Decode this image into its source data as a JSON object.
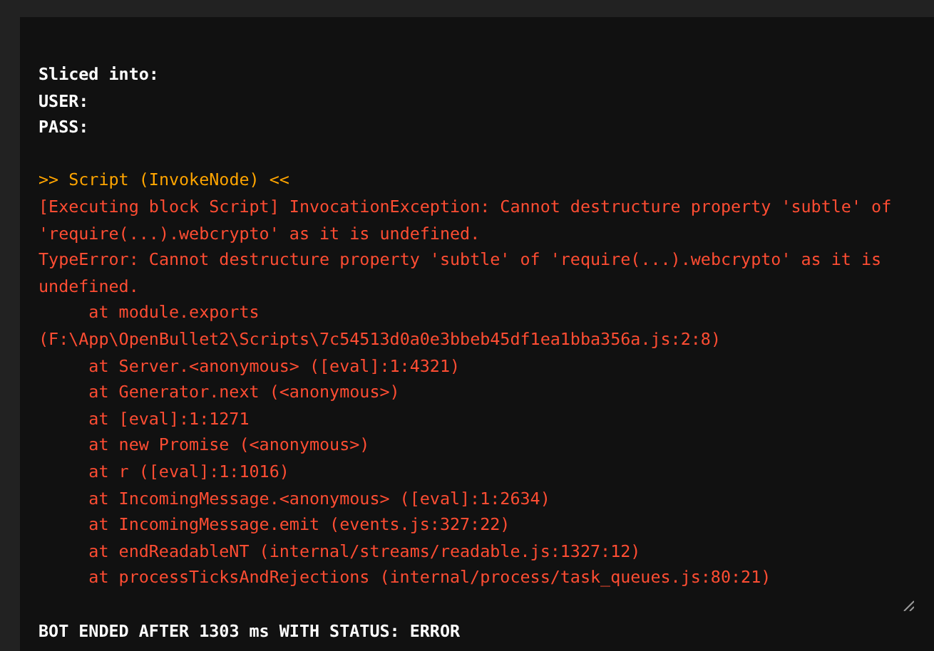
{
  "log": {
    "lines": [
      {
        "kind": "info",
        "text": "Sliced into:"
      },
      {
        "kind": "info",
        "text": "USER:"
      },
      {
        "kind": "info",
        "text": "PASS:"
      },
      {
        "kind": "blank"
      },
      {
        "kind": "header",
        "text": ">> Script (InvokeNode) <<"
      },
      {
        "kind": "error",
        "text": "[Executing block Script] InvocationException: Cannot destructure property 'subtle' of 'require(...).webcrypto' as it is undefined."
      },
      {
        "kind": "error",
        "text": "TypeError: Cannot destructure property 'subtle' of 'require(...).webcrypto' as it is undefined."
      },
      {
        "kind": "trace",
        "text": "at module.exports (F:\\App\\OpenBullet2\\Scripts\\7c54513d0a0e3bbeb45df1ea1bba356a.js:2:8)"
      },
      {
        "kind": "trace",
        "text": "at Server.<anonymous> ([eval]:1:4321)"
      },
      {
        "kind": "trace",
        "text": "at Generator.next (<anonymous>)"
      },
      {
        "kind": "trace",
        "text": "at [eval]:1:1271"
      },
      {
        "kind": "trace",
        "text": "at new Promise (<anonymous>)"
      },
      {
        "kind": "trace",
        "text": "at r ([eval]:1:1016)"
      },
      {
        "kind": "trace",
        "text": "at IncomingMessage.<anonymous> ([eval]:1:2634)"
      },
      {
        "kind": "trace",
        "text": "at IncomingMessage.emit (events.js:327:22)"
      },
      {
        "kind": "trace",
        "text": "at endReadableNT (internal/streams/readable.js:1327:12)"
      },
      {
        "kind": "trace",
        "text": "at processTicksAndRejections (internal/process/task_queues.js:80:21)"
      }
    ]
  },
  "status": "BOT ENDED AFTER 1303 ms WITH STATUS: ERROR"
}
